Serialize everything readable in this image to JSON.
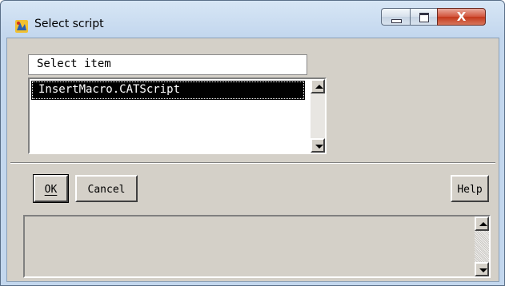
{
  "window": {
    "title": "Select script",
    "icon": "catia-app-icon",
    "caption_buttons": {
      "minimize": "minimize-icon",
      "maximize": "maximize-icon",
      "close": "close-icon",
      "close_glyph": "X"
    },
    "colors": {
      "frame": "#c3d7ee",
      "client": "#d4d0c8",
      "selection": "#000000",
      "close_button": "#c3381b"
    }
  },
  "select_field": {
    "label": "Select item"
  },
  "list": {
    "items": [
      {
        "label": "InsertMacro.CATScript",
        "selected": true
      }
    ]
  },
  "buttons": {
    "ok": "OK",
    "cancel": "Cancel",
    "help": "Help"
  },
  "message_area": {
    "text": ""
  }
}
